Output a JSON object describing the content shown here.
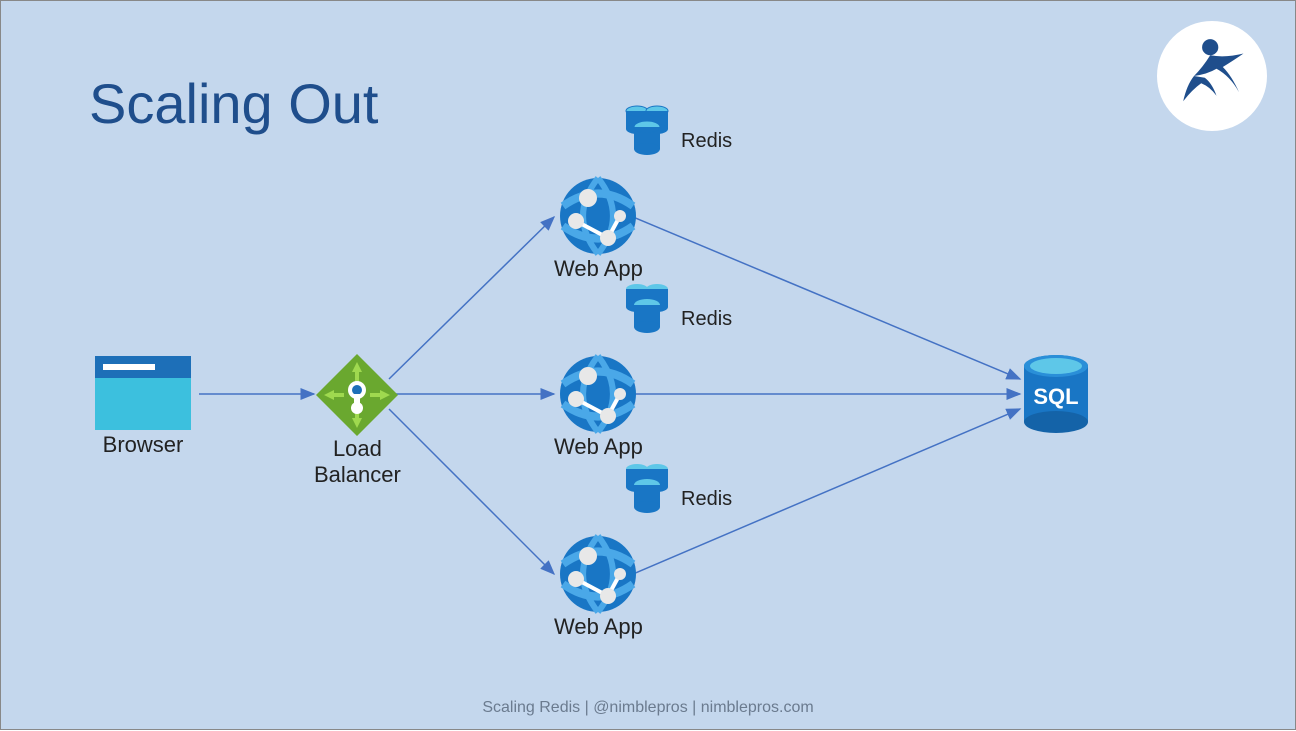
{
  "title": "Scaling Out",
  "footer": "Scaling Redis | @nimblepros | nimblepros.com",
  "nodes": {
    "browser": "Browser",
    "loadBalancer": "Load\nBalancer",
    "webApp1": "Web App",
    "webApp2": "Web App",
    "webApp3": "Web App",
    "redis1": "Redis",
    "redis2": "Redis",
    "redis3": "Redis",
    "sql": "SQL"
  },
  "colors": {
    "accent": "#1f4e8c",
    "arrow": "#4472c4",
    "bg": "#c4d7ed"
  }
}
